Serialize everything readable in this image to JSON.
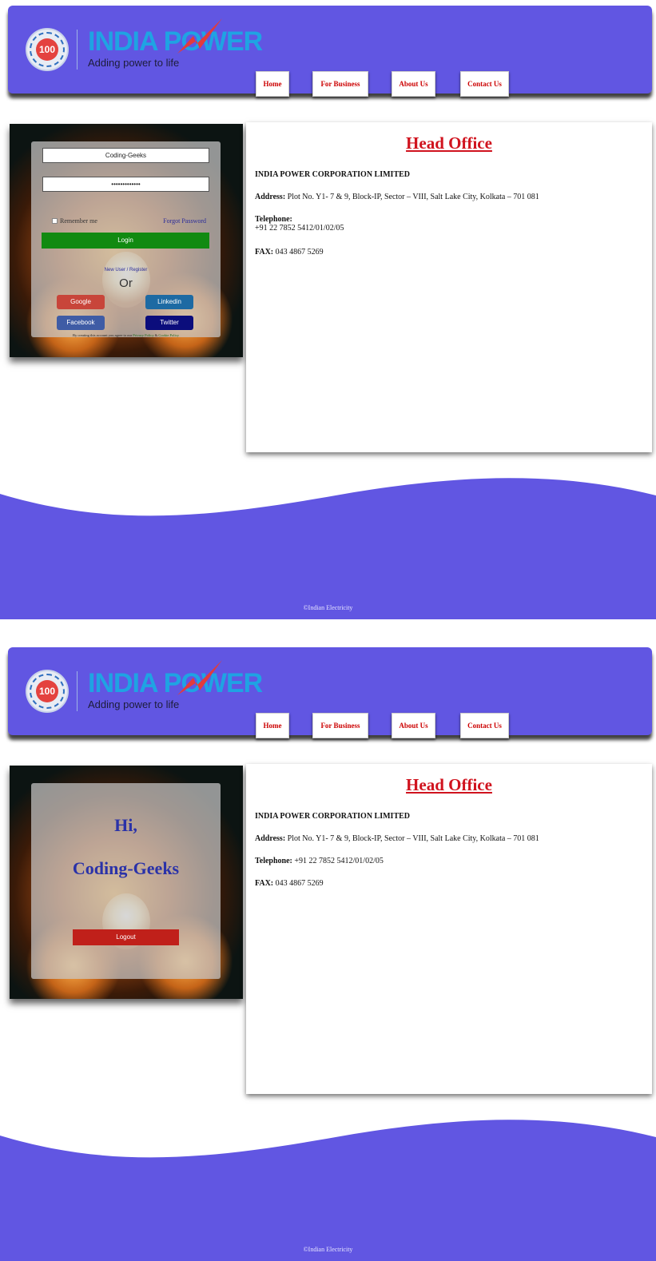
{
  "brand": {
    "seal_text": "100",
    "logo_word": "INDIA POWER",
    "tagline": "Adding power to life"
  },
  "nav": {
    "home": "Home",
    "business": "For Business",
    "about": "About Us",
    "contact": "Contact Us"
  },
  "login": {
    "username_value": "Coding-Geeks",
    "password_value": "•••••••••••••",
    "remember_label": "Remember me",
    "forgot_label": "Forgot Password",
    "login_label": "Login",
    "register_label": "New User / Register",
    "or_label": "Or",
    "google_label": "Google",
    "linkedin_label": "Linkedin",
    "facebook_label": "Facebook",
    "twitter_label": "Twitter",
    "terms_prefix": "By creating this account you agree to our ",
    "privacy_label": "Privacy Policy",
    "terms_and": " & ",
    "cookie_label": "Cookie Policy"
  },
  "loggedin": {
    "hi": "Hi,",
    "username": "Coding-Geeks",
    "logout_label": "Logout"
  },
  "office": {
    "title": "Head Office",
    "company": "INDIA POWER CORPORATION LIMITED",
    "address_label": "Address:",
    "address": " Plot No. Y1- 7 & 9, Block-IP, Sector – VIII, Salt Lake City, Kolkata – 701 081",
    "telephone_label": "Telephone:",
    "telephone": "+91 22 7852 5412/01/02/05",
    "fax_label": "FAX:",
    "fax": " 043 4867 5269"
  },
  "footer": {
    "copyright": "©Indian Electricity"
  },
  "colors": {
    "brand_purple": "#6156e2",
    "nav_text": "#cc0000",
    "login_green": "#118a11",
    "google_red": "#c8453a",
    "linkedin_blue": "#1d6aa3",
    "facebook_blue": "#3f5ca5",
    "twitter_navy": "#0b0d7c",
    "logout_red": "#c0201a",
    "heading_red": "#d0131e"
  }
}
